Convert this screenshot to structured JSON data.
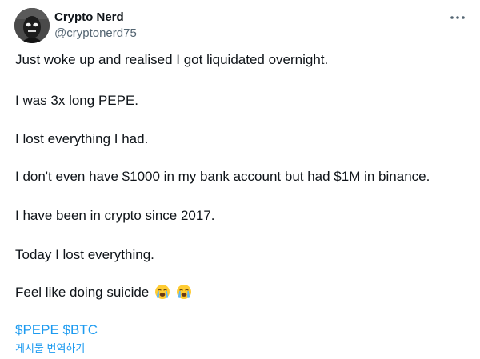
{
  "user": {
    "display_name": "Crypto Nerd",
    "handle": "@cryptonerd75",
    "avatar_icon": "masked-person-avatar"
  },
  "menu": {
    "more_icon": "more-horizontal-icon"
  },
  "tweet": {
    "lines": [
      "Just woke up and realised I got liquidated overnight.",
      "I was 3x long PEPE.",
      "I lost everything I had.",
      "I don't even have $1000 in my bank account but had $1M in binance.",
      "I have been in crypto since 2017.",
      "Today I lost everything.",
      "Feel like doing suicide"
    ],
    "emojis": [
      "loudly-crying-face",
      "loudly-crying-face"
    ],
    "cashtags": [
      "$PEPE",
      "$BTC"
    ]
  },
  "translate_label": "게시물 번역하기",
  "colors": {
    "accent": "#1d9bf0",
    "secondary_text": "#536471",
    "primary_text": "#0f1419"
  }
}
